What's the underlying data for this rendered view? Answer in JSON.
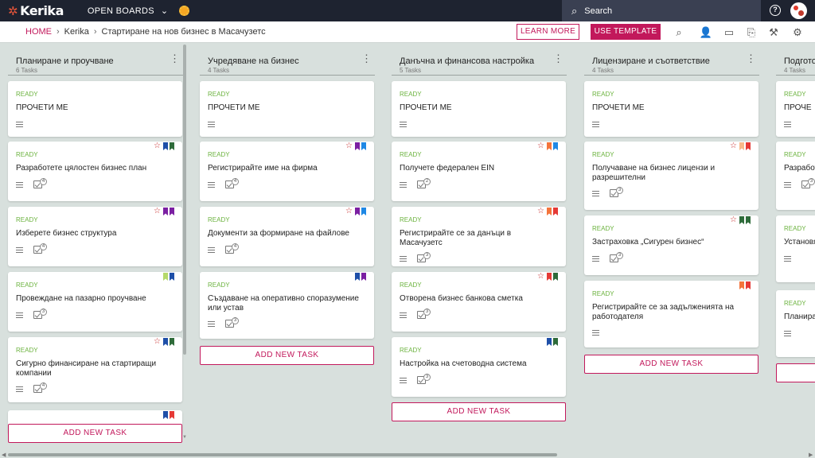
{
  "topbar": {
    "logo": "Kerika",
    "open_boards": "OPEN BOARDS",
    "search_label": "Search"
  },
  "breadcrumb": {
    "home": "HOME",
    "project": "Kerika",
    "board": "Стартиране на нов бизнес в Масачузетс"
  },
  "actions": {
    "learn_more": "LEARN MORE",
    "use_template": "USE TEMPLATE"
  },
  "add_task_label": "ADD NEW TASK",
  "colors": {
    "accent": "#c2185b",
    "ready": "#6cb33f",
    "topbar": "#1e2330",
    "board_bg": "#d8e0dd"
  },
  "columns": [
    {
      "title": "Планиране и проучване",
      "count": "6 Tasks",
      "cards": [
        {
          "status": "READY",
          "title": "ПРОЧЕТИ МЕ",
          "flags": [],
          "checklist": null
        },
        {
          "status": "READY",
          "title": "Разработете цялостен бизнес план",
          "star": true,
          "flags": [
            "#1e4fa8",
            "#2e6b3a"
          ],
          "checklist": "4"
        },
        {
          "status": "READY",
          "title": "Изберете бизнес структура",
          "star": true,
          "flags": [
            "#7b1fa2",
            "#7b1fa2"
          ],
          "checklist": "4"
        },
        {
          "status": "READY",
          "title": "Провеждане на пазарно проучване",
          "flags": [
            "#b5d96b",
            "#1e4fa8"
          ],
          "checklist": "3"
        },
        {
          "status": "READY",
          "title": "Сигурно финансиране на стартиращи компании",
          "star": true,
          "flags": [
            "#1e4fa8",
            "#2e6b3a"
          ],
          "checklist": "4"
        },
        {
          "status": "",
          "title": "",
          "flags": [
            "#1e4fa8",
            "#e53935"
          ],
          "checklist": null
        }
      ]
    },
    {
      "title": "Учредяване на бизнес",
      "count": "4 Tasks",
      "cards": [
        {
          "status": "READY",
          "title": "ПРОЧЕТИ МЕ",
          "flags": [],
          "checklist": null
        },
        {
          "status": "READY",
          "title": "Регистрирайте име на фирма",
          "star": true,
          "flags": [
            "#7b1fa2",
            "#1e88e5"
          ],
          "checklist": "4"
        },
        {
          "status": "READY",
          "title": "Документи за формиране на файлове",
          "star": true,
          "flags": [
            "#7b1fa2",
            "#1e88e5"
          ],
          "checklist": "4"
        },
        {
          "status": "READY",
          "title": "Създаване на оперативно споразумение или устав",
          "flags": [
            "#1e4fa8",
            "#7b1fa2"
          ],
          "checklist": "3"
        }
      ]
    },
    {
      "title": "Данъчна и финансова настройка",
      "count": "5 Tasks",
      "cards": [
        {
          "status": "READY",
          "title": "ПРОЧЕТИ МЕ",
          "flags": [],
          "checklist": null
        },
        {
          "status": "READY",
          "title": "Получете федерален EIN",
          "star": true,
          "flags": [
            "#f4743b",
            "#1e88e5"
          ],
          "checklist": "2"
        },
        {
          "status": "READY",
          "title": "Регистрирайте се за данъци в Масачузетс",
          "star": true,
          "flags": [
            "#f4743b",
            "#e53935"
          ],
          "checklist": "3"
        },
        {
          "status": "READY",
          "title": "Отворена бизнес банкова сметка",
          "star": true,
          "flags": [
            "#e53935",
            "#2e6b3a"
          ],
          "checklist": "3"
        },
        {
          "status": "READY",
          "title": "Настройка на счетоводна система",
          "flags": [
            "#1e4fa8",
            "#2e6b3a"
          ],
          "checklist": "3"
        }
      ]
    },
    {
      "title": "Лицензиране и съответствие",
      "count": "4 Tasks",
      "cards": [
        {
          "status": "READY",
          "title": "ПРОЧЕТИ МЕ",
          "flags": [],
          "checklist": null
        },
        {
          "status": "READY",
          "title": "Получаване на бизнес лицензи и разрешителни",
          "star": true,
          "flags": [
            "#f9b98a",
            "#e53935"
          ],
          "checklist": "3"
        },
        {
          "status": "READY",
          "title": "Застраховка „Сигурен бизнес“",
          "star": true,
          "flags": [
            "#2e6b3a",
            "#2e6b3a"
          ],
          "checklist": "3"
        },
        {
          "status": "READY",
          "title": "Регистрирайте се за задълженията на работодателя",
          "flags": [
            "#f4743b",
            "#e53935"
          ],
          "checklist": null
        }
      ]
    },
    {
      "title": "Подгото",
      "count": "4 Tasks",
      "cards": [
        {
          "status": "READY",
          "title": "ПРОЧЕ",
          "flags": [],
          "checklist": null
        },
        {
          "status": "READY",
          "title": "Разработе маркетин",
          "flags": [],
          "checklist": "3"
        },
        {
          "status": "READY",
          "title": "Установя доставчи",
          "flags": [],
          "checklist": null
        },
        {
          "status": "READY",
          "title": "Планира стратегия",
          "flags": [],
          "checklist": null
        }
      ]
    }
  ]
}
